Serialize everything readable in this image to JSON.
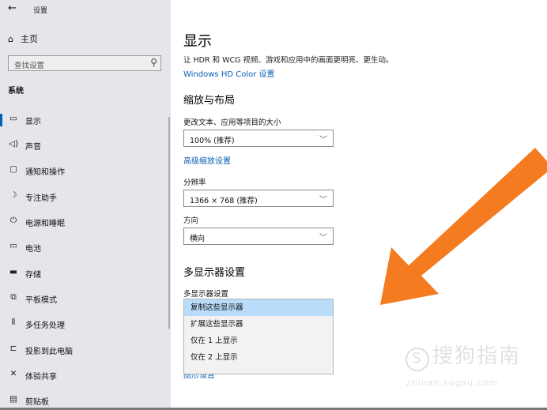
{
  "window": {
    "title": "设置"
  },
  "sidebar": {
    "home_label": "主页",
    "search_placeholder": "查找设置",
    "group_label": "系统",
    "items": [
      {
        "label": "显示",
        "icon": "monitor-icon"
      },
      {
        "label": "声音",
        "icon": "speaker-icon"
      },
      {
        "label": "通知和操作",
        "icon": "notification-icon"
      },
      {
        "label": "专注助手",
        "icon": "moon-icon"
      },
      {
        "label": "电源和睡眠",
        "icon": "power-icon"
      },
      {
        "label": "电池",
        "icon": "battery-icon"
      },
      {
        "label": "存储",
        "icon": "storage-icon"
      },
      {
        "label": "平板模式",
        "icon": "tablet-icon"
      },
      {
        "label": "多任务处理",
        "icon": "multitask-icon"
      },
      {
        "label": "投影到此电脑",
        "icon": "project-icon"
      },
      {
        "label": "体验共享",
        "icon": "share-icon"
      },
      {
        "label": "剪贴板",
        "icon": "clipboard-icon"
      }
    ]
  },
  "main": {
    "title": "显示",
    "hdr_description": "让 HDR 和 WCG 视频、游戏和应用中的画面更明亮、更生动。",
    "hdr_link": "Windows HD Color 设置",
    "scale_section": "缩放与布局",
    "text_size_label": "更改文本、应用等项目的大小",
    "text_size_value": "100% (推荐)",
    "advanced_scaling_link": "高级缩放设置",
    "resolution_label": "分辨率",
    "resolution_value": "1366 × 768 (推荐)",
    "orientation_label": "方向",
    "orientation_value": "横向",
    "multi_display_section": "多显示器设置",
    "multi_display_label": "多显示器设置",
    "multi_display_options": [
      "复制这些显示器",
      "扩展这些显示器",
      "仅在 1 上显示",
      "仅在 2 上显示"
    ],
    "selected_option": "复制这些显示器",
    "partial_link": "图形设置"
  },
  "watermark": {
    "text": "搜狗指南",
    "sub": "zhinan.sogou.com"
  },
  "colors": {
    "accent": "#0063b1",
    "link": "#0a5fb8",
    "arrow": "#f47b20",
    "dropdown_selected": "#b8dcf9"
  }
}
